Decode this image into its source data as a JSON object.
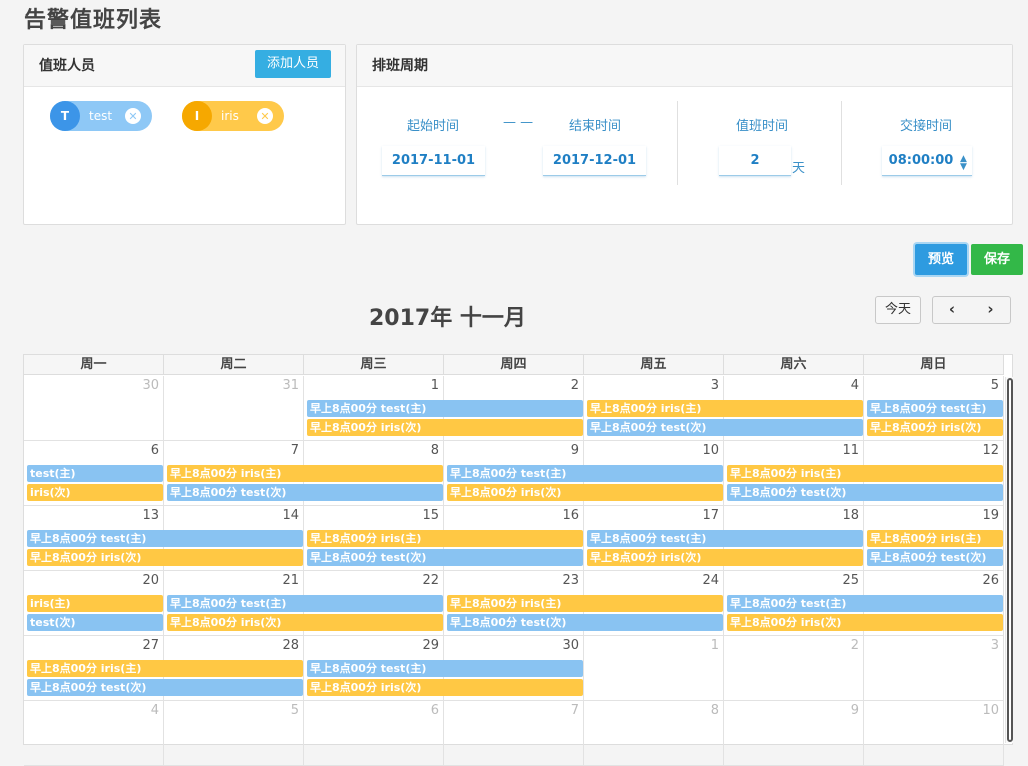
{
  "page": {
    "title": "告警值班列表"
  },
  "staff_panel": {
    "title": "值班人员",
    "add_label": "添加人员",
    "people": [
      {
        "initial": "T",
        "name": "test",
        "color": "blue"
      },
      {
        "initial": "I",
        "name": "iris",
        "color": "yellow"
      }
    ]
  },
  "schedule_panel": {
    "title": "排班周期",
    "start_label": "起始时间",
    "separator": "— —",
    "end_label": "结束时间",
    "duty_label": "值班时间",
    "handover_label": "交接时间",
    "start_value": "2017-11-01",
    "end_value": "2017-12-01",
    "duty_value": "2",
    "duty_unit": "天",
    "handover_value": "08:00:00"
  },
  "actions": {
    "preview": "预览",
    "save": "保存"
  },
  "calendar": {
    "title": "2017年 十一月",
    "today_label": "今天",
    "prev": "‹",
    "next": "›",
    "weekdays": [
      "周一",
      "周二",
      "周三",
      "周四",
      "周五",
      "周六",
      "周日"
    ],
    "weeks": [
      [
        "30",
        "31",
        "1",
        "2",
        "3",
        "4",
        "5"
      ],
      [
        "6",
        "7",
        "8",
        "9",
        "10",
        "11",
        "12"
      ],
      [
        "13",
        "14",
        "15",
        "16",
        "17",
        "18",
        "19"
      ],
      [
        "20",
        "21",
        "22",
        "23",
        "24",
        "25",
        "26"
      ],
      [
        "27",
        "28",
        "29",
        "30",
        "1",
        "2",
        "3"
      ],
      [
        "4",
        "5",
        "6",
        "7",
        "8",
        "9",
        "10"
      ]
    ],
    "other_month": [
      [
        true,
        true,
        false,
        false,
        false,
        false,
        false
      ],
      [
        false,
        false,
        false,
        false,
        false,
        false,
        false
      ],
      [
        false,
        false,
        false,
        false,
        false,
        false,
        false
      ],
      [
        false,
        false,
        false,
        false,
        false,
        false,
        false
      ],
      [
        false,
        false,
        false,
        false,
        true,
        true,
        true
      ],
      [
        true,
        true,
        true,
        true,
        true,
        true,
        true
      ]
    ],
    "events": [
      {
        "week": 0,
        "start": 2,
        "span": 2,
        "lane": 0,
        "color": "blue",
        "text": "早上8点00分 test(主)"
      },
      {
        "week": 0,
        "start": 2,
        "span": 2,
        "lane": 1,
        "color": "yellow",
        "text": "早上8点00分 iris(次)"
      },
      {
        "week": 0,
        "start": 4,
        "span": 2,
        "lane": 0,
        "color": "yellow",
        "text": "早上8点00分 iris(主)"
      },
      {
        "week": 0,
        "start": 4,
        "span": 2,
        "lane": 1,
        "color": "blue",
        "text": "早上8点00分 test(次)"
      },
      {
        "week": 0,
        "start": 6,
        "span": 1,
        "lane": 0,
        "color": "blue",
        "text": "早上8点00分 test(主)"
      },
      {
        "week": 0,
        "start": 6,
        "span": 1,
        "lane": 1,
        "color": "yellow",
        "text": "早上8点00分 iris(次)"
      },
      {
        "week": 1,
        "start": 0,
        "span": 1,
        "lane": 0,
        "color": "blue",
        "text": "test(主)"
      },
      {
        "week": 1,
        "start": 0,
        "span": 1,
        "lane": 1,
        "color": "yellow",
        "text": "iris(次)"
      },
      {
        "week": 1,
        "start": 1,
        "span": 2,
        "lane": 0,
        "color": "yellow",
        "text": "早上8点00分 iris(主)"
      },
      {
        "week": 1,
        "start": 1,
        "span": 2,
        "lane": 1,
        "color": "blue",
        "text": "早上8点00分 test(次)"
      },
      {
        "week": 1,
        "start": 3,
        "span": 2,
        "lane": 0,
        "color": "blue",
        "text": "早上8点00分 test(主)"
      },
      {
        "week": 1,
        "start": 3,
        "span": 2,
        "lane": 1,
        "color": "yellow",
        "text": "早上8点00分 iris(次)"
      },
      {
        "week": 1,
        "start": 5,
        "span": 2,
        "lane": 0,
        "color": "yellow",
        "text": "早上8点00分 iris(主)"
      },
      {
        "week": 1,
        "start": 5,
        "span": 2,
        "lane": 1,
        "color": "blue",
        "text": "早上8点00分 test(次)"
      },
      {
        "week": 2,
        "start": 0,
        "span": 2,
        "lane": 0,
        "color": "blue",
        "text": "早上8点00分 test(主)"
      },
      {
        "week": 2,
        "start": 0,
        "span": 2,
        "lane": 1,
        "color": "yellow",
        "text": "早上8点00分 iris(次)"
      },
      {
        "week": 2,
        "start": 2,
        "span": 2,
        "lane": 0,
        "color": "yellow",
        "text": "早上8点00分 iris(主)"
      },
      {
        "week": 2,
        "start": 2,
        "span": 2,
        "lane": 1,
        "color": "blue",
        "text": "早上8点00分 test(次)"
      },
      {
        "week": 2,
        "start": 4,
        "span": 2,
        "lane": 0,
        "color": "blue",
        "text": "早上8点00分 test(主)"
      },
      {
        "week": 2,
        "start": 4,
        "span": 2,
        "lane": 1,
        "color": "yellow",
        "text": "早上8点00分 iris(次)"
      },
      {
        "week": 2,
        "start": 6,
        "span": 1,
        "lane": 0,
        "color": "yellow",
        "text": "早上8点00分 iris(主)"
      },
      {
        "week": 2,
        "start": 6,
        "span": 1,
        "lane": 1,
        "color": "blue",
        "text": "早上8点00分 test(次)"
      },
      {
        "week": 3,
        "start": 0,
        "span": 1,
        "lane": 0,
        "color": "yellow",
        "text": "iris(主)"
      },
      {
        "week": 3,
        "start": 0,
        "span": 1,
        "lane": 1,
        "color": "blue",
        "text": "test(次)"
      },
      {
        "week": 3,
        "start": 1,
        "span": 2,
        "lane": 0,
        "color": "blue",
        "text": "早上8点00分 test(主)"
      },
      {
        "week": 3,
        "start": 1,
        "span": 2,
        "lane": 1,
        "color": "yellow",
        "text": "早上8点00分 iris(次)"
      },
      {
        "week": 3,
        "start": 3,
        "span": 2,
        "lane": 0,
        "color": "yellow",
        "text": "早上8点00分 iris(主)"
      },
      {
        "week": 3,
        "start": 3,
        "span": 2,
        "lane": 1,
        "color": "blue",
        "text": "早上8点00分 test(次)"
      },
      {
        "week": 3,
        "start": 5,
        "span": 2,
        "lane": 0,
        "color": "blue",
        "text": "早上8点00分 test(主)"
      },
      {
        "week": 3,
        "start": 5,
        "span": 2,
        "lane": 1,
        "color": "yellow",
        "text": "早上8点00分 iris(次)"
      },
      {
        "week": 4,
        "start": 0,
        "span": 2,
        "lane": 0,
        "color": "yellow",
        "text": "早上8点00分 iris(主)"
      },
      {
        "week": 4,
        "start": 0,
        "span": 2,
        "lane": 1,
        "color": "blue",
        "text": "早上8点00分 test(次)"
      },
      {
        "week": 4,
        "start": 2,
        "span": 2,
        "lane": 0,
        "color": "blue",
        "text": "早上8点00分 test(主)"
      },
      {
        "week": 4,
        "start": 2,
        "span": 2,
        "lane": 1,
        "color": "yellow",
        "text": "早上8点00分 iris(次)"
      }
    ]
  }
}
